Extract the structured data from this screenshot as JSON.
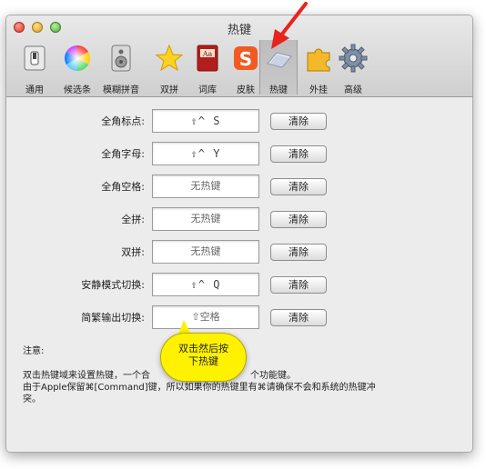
{
  "window": {
    "title": "热键"
  },
  "toolbar": {
    "items": [
      {
        "label": "通用",
        "icon": "switch-icon"
      },
      {
        "label": "候选条",
        "icon": "color-wheel-icon"
      },
      {
        "label": "模糊拼音",
        "icon": "speaker-icon"
      },
      {
        "label": "双拼",
        "icon": "star-icon"
      },
      {
        "label": "词库",
        "icon": "dictionary-icon"
      },
      {
        "label": "皮肤",
        "icon": "sogou-logo-icon"
      },
      {
        "label": "热键",
        "icon": "keyboard-icon"
      },
      {
        "label": "外挂",
        "icon": "puzzle-icon"
      },
      {
        "label": "高级",
        "icon": "gear-icon"
      }
    ],
    "selected": "热键"
  },
  "hotkeys": [
    {
      "label": "全角标点:",
      "value": "⇧^ S"
    },
    {
      "label": "全角字母:",
      "value": "⇧^ Y"
    },
    {
      "label": "全角空格:",
      "value": "无热键"
    },
    {
      "label": "全拼:",
      "value": "无热键"
    },
    {
      "label": "双拼:",
      "value": "无热键"
    },
    {
      "label": "安静模式切换:",
      "value": "⇧^ Q"
    },
    {
      "label": "简繁输出切换:",
      "value": "⇧空格"
    }
  ],
  "clear_label": "清除",
  "notes": {
    "heading": "注意:",
    "line1": "双击热键域来设置热键，一个合",
    "line1_end": "个功能键。",
    "line2": "由于Apple保留⌘[Command]键，所以如果你的热键里有⌘请确保不会和系统的热键冲",
    "line3": "突。"
  },
  "tooltip": {
    "line1": "双击然后按",
    "line2": "下热键"
  },
  "colors": {
    "tooltip": "#fef200",
    "arrow": "#e8231d"
  }
}
